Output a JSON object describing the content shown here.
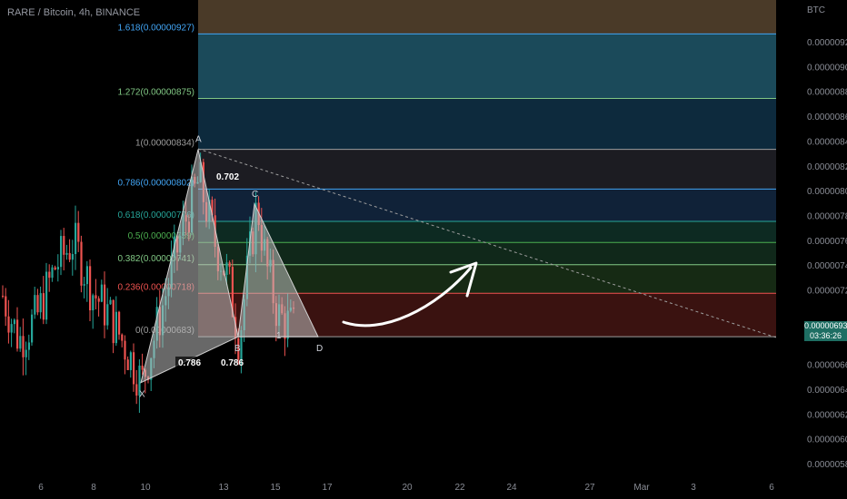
{
  "title": "RARE / Bitcoin, 4h, BINANCE",
  "currency": "BTC",
  "last_price": "0.00000693",
  "countdown": "03:36:26",
  "colors": {
    "up": "#26a69a",
    "down": "#ef5350",
    "background": "#000000",
    "pattern_fill": "#bdbdbd"
  },
  "price_axis": {
    "min": 5.7e-06,
    "max": 9.4e-06,
    "ticks": [
      "0.00000920",
      "0.00000900",
      "0.00000880",
      "0.00000860",
      "0.00000840",
      "0.00000820",
      "0.00000800",
      "0.00000780",
      "0.00000760",
      "0.00000740",
      "0.00000720",
      "0.00000660",
      "0.00000640",
      "0.00000620",
      "0.00000600",
      "0.00000580"
    ],
    "tick_values": [
      9.2e-06,
      9e-06,
      8.8e-06,
      8.6e-06,
      8.4e-06,
      8.2e-06,
      8e-06,
      7.8e-06,
      7.6e-06,
      7.4e-06,
      7.2e-06,
      6.6e-06,
      6.4e-06,
      6.2e-06,
      6e-06,
      5.8e-06
    ]
  },
  "time_axis": {
    "labels": [
      "6",
      "8",
      "10",
      "13",
      "15",
      "17",
      "20",
      "22",
      "24",
      "27",
      "Mar",
      "3",
      "6"
    ]
  },
  "fib_levels": [
    {
      "label": "1.618(0.00000927)",
      "value": 9.27e-06,
      "color": "#42a5f5",
      "fill": "#1b4a5a"
    },
    {
      "label": "1.272(0.00000875)",
      "value": 8.75e-06,
      "color": "#81c784",
      "fill": "#0d2a3d"
    },
    {
      "label": "1(0.00000834)",
      "value": 8.34e-06,
      "color": "#9e9e9e",
      "fill": "#1c1c22"
    },
    {
      "label": "0.786(0.00000802)",
      "value": 8.02e-06,
      "color": "#42a5f5",
      "fill": "#102238"
    },
    {
      "label": "0.618(0.00000776)",
      "value": 7.76e-06,
      "color": "#26a69a",
      "fill": "#0d2a22"
    },
    {
      "label": "0.5(0.00000759)",
      "value": 7.59e-06,
      "color": "#4caf50",
      "fill": "#10281a"
    },
    {
      "label": "0.382(0.00000741)",
      "value": 7.41e-06,
      "color": "#81c784",
      "fill": "#162a14"
    },
    {
      "label": "0.236(0.00000718)",
      "value": 7.18e-06,
      "color": "#ef5350",
      "fill": "#3a1210"
    },
    {
      "label": "0(0.00000683)",
      "value": 6.83e-06,
      "color": "#9e9e9e",
      "fill": "none"
    }
  ],
  "pattern": {
    "points": [
      {
        "name": "X",
        "price": 6.46e-06
      },
      {
        "name": "A",
        "price": 8.34e-06
      },
      {
        "name": "B",
        "price": 6.83e-06
      },
      {
        "name": "C",
        "price": 7.9e-06
      },
      {
        "name": "D",
        "price": 6.83e-06
      }
    ],
    "ratios": [
      "0.702",
      "0.786",
      "0.786"
    ]
  },
  "annotation_label": "1"
}
